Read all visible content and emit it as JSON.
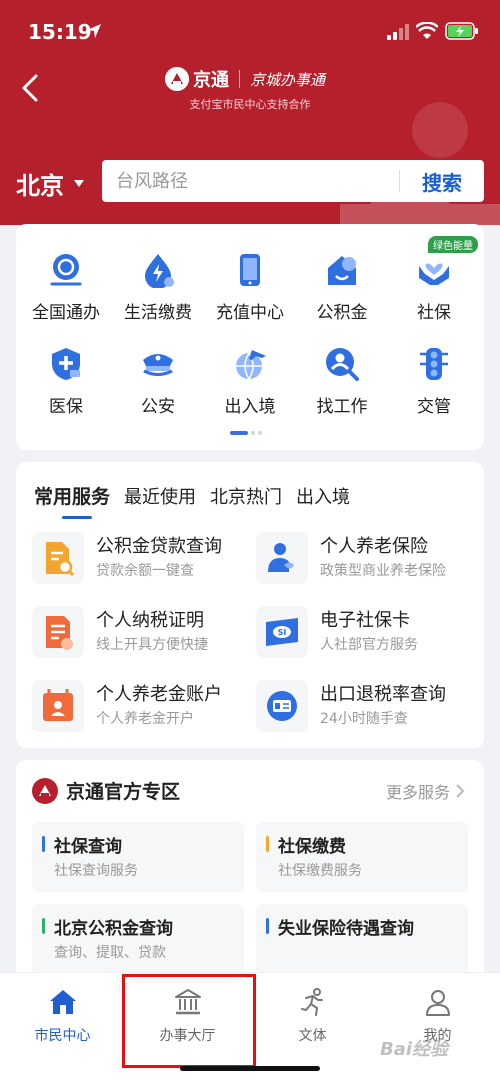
{
  "status_bar": {
    "time": "15:19"
  },
  "header": {
    "brand_name": "京通",
    "brand_script": "京城办事通",
    "subtitle": "支付宝市民中心支持合作",
    "city": "北京",
    "search_placeholder": "台风路径",
    "search_button": "搜索",
    "colors": {
      "primary": "#b5202c",
      "accent": "#1f5fd0"
    }
  },
  "grid": {
    "items": [
      {
        "label": "全国通办",
        "icon": "globe-service-icon"
      },
      {
        "label": "生活缴费",
        "icon": "water-drop-bolt-icon"
      },
      {
        "label": "充值中心",
        "icon": "phone-icon"
      },
      {
        "label": "公积金",
        "icon": "house-fund-icon"
      },
      {
        "label": "社保",
        "icon": "hands-heart-icon"
      },
      {
        "label": "医保",
        "icon": "medical-shield-icon"
      },
      {
        "label": "公安",
        "icon": "police-cap-icon"
      },
      {
        "label": "出入境",
        "icon": "airplane-globe-icon"
      },
      {
        "label": "找工作",
        "icon": "person-search-icon"
      },
      {
        "label": "交管",
        "icon": "traffic-light-icon"
      }
    ],
    "badge": "绿色能量"
  },
  "services": {
    "tabs": [
      "常用服务",
      "最近使用",
      "北京热门",
      "出入境"
    ],
    "items": [
      {
        "title": "公积金贷款查询",
        "desc": "贷款余额一键查",
        "icon": "document-search-icon"
      },
      {
        "title": "个人养老保险",
        "desc": "政策型商业养老保险",
        "icon": "person-insurance-icon"
      },
      {
        "title": "个人纳税证明",
        "desc": "线上开具方便快捷",
        "icon": "tax-document-icon"
      },
      {
        "title": "电子社保卡",
        "desc": "人社部官方服务",
        "icon": "social-card-icon"
      },
      {
        "title": "个人养老金账户",
        "desc": "个人养老金开户",
        "icon": "calendar-person-icon"
      },
      {
        "title": "出口退税率查询",
        "desc": "24小时随手查",
        "icon": "id-card-icon"
      }
    ]
  },
  "zone": {
    "title": "京通官方专区",
    "more": "更多服务",
    "items": [
      {
        "title": "社保查询",
        "desc": "社保查询服务",
        "bar_color": "#2f6fe0"
      },
      {
        "title": "社保缴费",
        "desc": "社保缴费服务",
        "bar_color": "#f2a531"
      },
      {
        "title": "北京公积金查询",
        "desc": "查询、提取、贷款",
        "bar_color": "#2fb06a"
      },
      {
        "title": "失业保险待遇查询",
        "desc": "",
        "bar_color": "#2f6fe0"
      }
    ]
  },
  "bottom_nav": {
    "items": [
      {
        "label": "市民中心",
        "icon": "home-icon",
        "active": true
      },
      {
        "label": "办事大厅",
        "icon": "bank-building-icon",
        "active": false
      },
      {
        "label": "文体",
        "icon": "running-person-icon",
        "active": false
      },
      {
        "label": "我的",
        "icon": "user-icon",
        "active": false
      }
    ]
  },
  "watermark": "Bai经验"
}
